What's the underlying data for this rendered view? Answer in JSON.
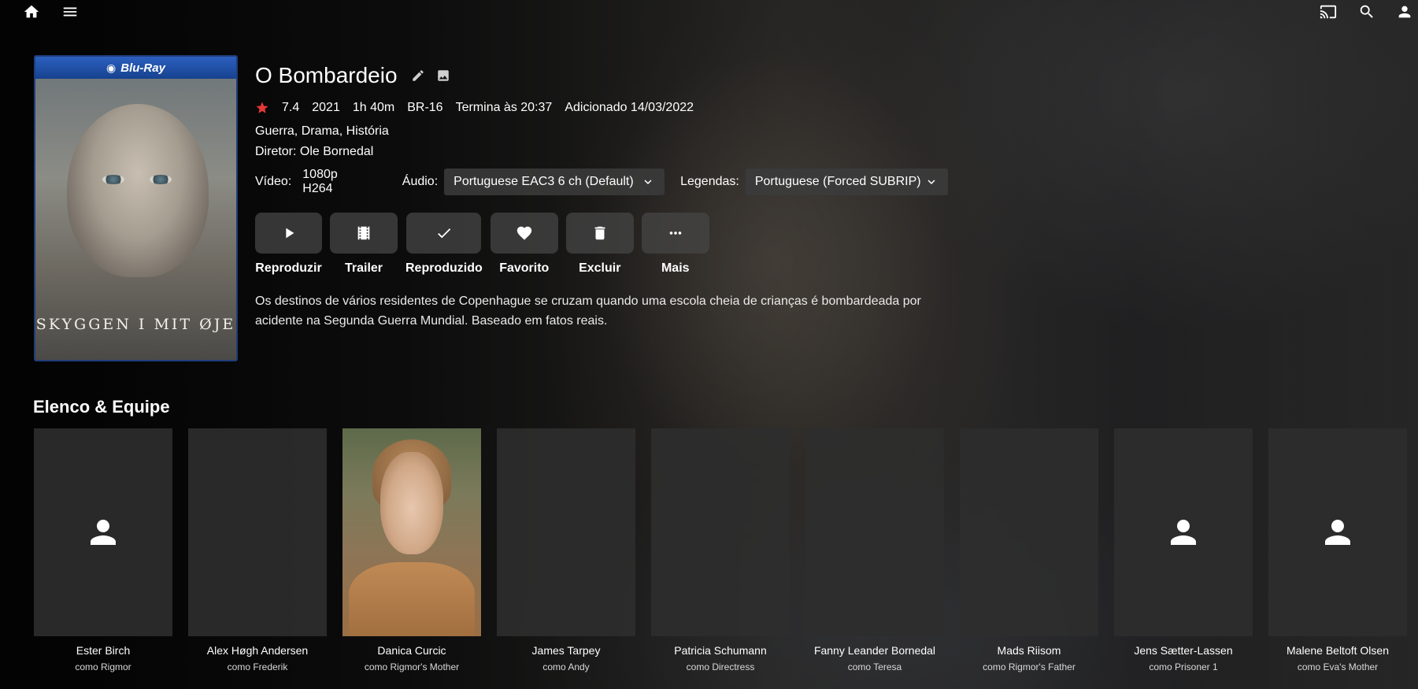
{
  "topbar": {
    "left_icons": [
      "home-icon",
      "menu-icon"
    ],
    "right_icons": [
      "cast-icon",
      "search-icon",
      "user-icon"
    ]
  },
  "poster": {
    "badge": "Blu-Ray",
    "title": "SKYGGEN I MIT ØJE"
  },
  "movie": {
    "title": "O Bombardeio",
    "rating": "7.4",
    "year": "2021",
    "runtime": "1h 40m",
    "age_rating": "BR-16",
    "ends_at": "Termina às 20:37",
    "added": "Adicionado 14/03/2022",
    "genres": "Guerra, Drama, História",
    "director": "Diretor: Ole Bornedal",
    "overview": "Os destinos de vários residentes de Copenhague se cruzam quando uma escola cheia de crianças é bombardeada por acidente na Segunda Guerra Mundial. Baseado em fatos reais."
  },
  "streams": {
    "video_label": "Vídeo:",
    "video_value": "1080p H264",
    "audio_label": "Áudio:",
    "audio_value": "Portuguese EAC3 6 ch (Default)",
    "subs_label": "Legendas:",
    "subs_value": "Portuguese (Forced SUBRIP)"
  },
  "actions": [
    {
      "label": "Reproduzir",
      "icon": "play-icon"
    },
    {
      "label": "Trailer",
      "icon": "film-icon"
    },
    {
      "label": "Reproduzido",
      "icon": "check-icon"
    },
    {
      "label": "Favorito",
      "icon": "heart-icon"
    },
    {
      "label": "Excluir",
      "icon": "trash-icon"
    },
    {
      "label": "Mais",
      "icon": "more-icon"
    }
  ],
  "cast_section": {
    "title": "Elenco & Equipe",
    "members": [
      {
        "name": "Ester Birch",
        "role": "como Rigmor",
        "photo": "placeholder-icon"
      },
      {
        "name": "Alex Høgh Andersen",
        "role": "como Frederik",
        "photo": "none"
      },
      {
        "name": "Danica Curcic",
        "role": "como Rigmor's Mother",
        "photo": "portrait"
      },
      {
        "name": "James Tarpey",
        "role": "como Andy",
        "photo": "none"
      },
      {
        "name": "Patricia Schumann",
        "role": "como Directress",
        "photo": "none"
      },
      {
        "name": "Fanny Leander Bornedal",
        "role": "como Teresa",
        "photo": "none"
      },
      {
        "name": "Mads Riisom",
        "role": "como Rigmor's Father",
        "photo": "none"
      },
      {
        "name": "Jens Sætter-Lassen",
        "role": "como Prisoner 1",
        "photo": "placeholder-icon"
      },
      {
        "name": "Malene Beltoft Olsen",
        "role": "como Eva's Mother",
        "photo": "placeholder-icon"
      }
    ]
  },
  "colors": {
    "rating_star": "#e53935",
    "poster_border": "#1f3d7a",
    "bluray_band": "#2c5fbf"
  }
}
